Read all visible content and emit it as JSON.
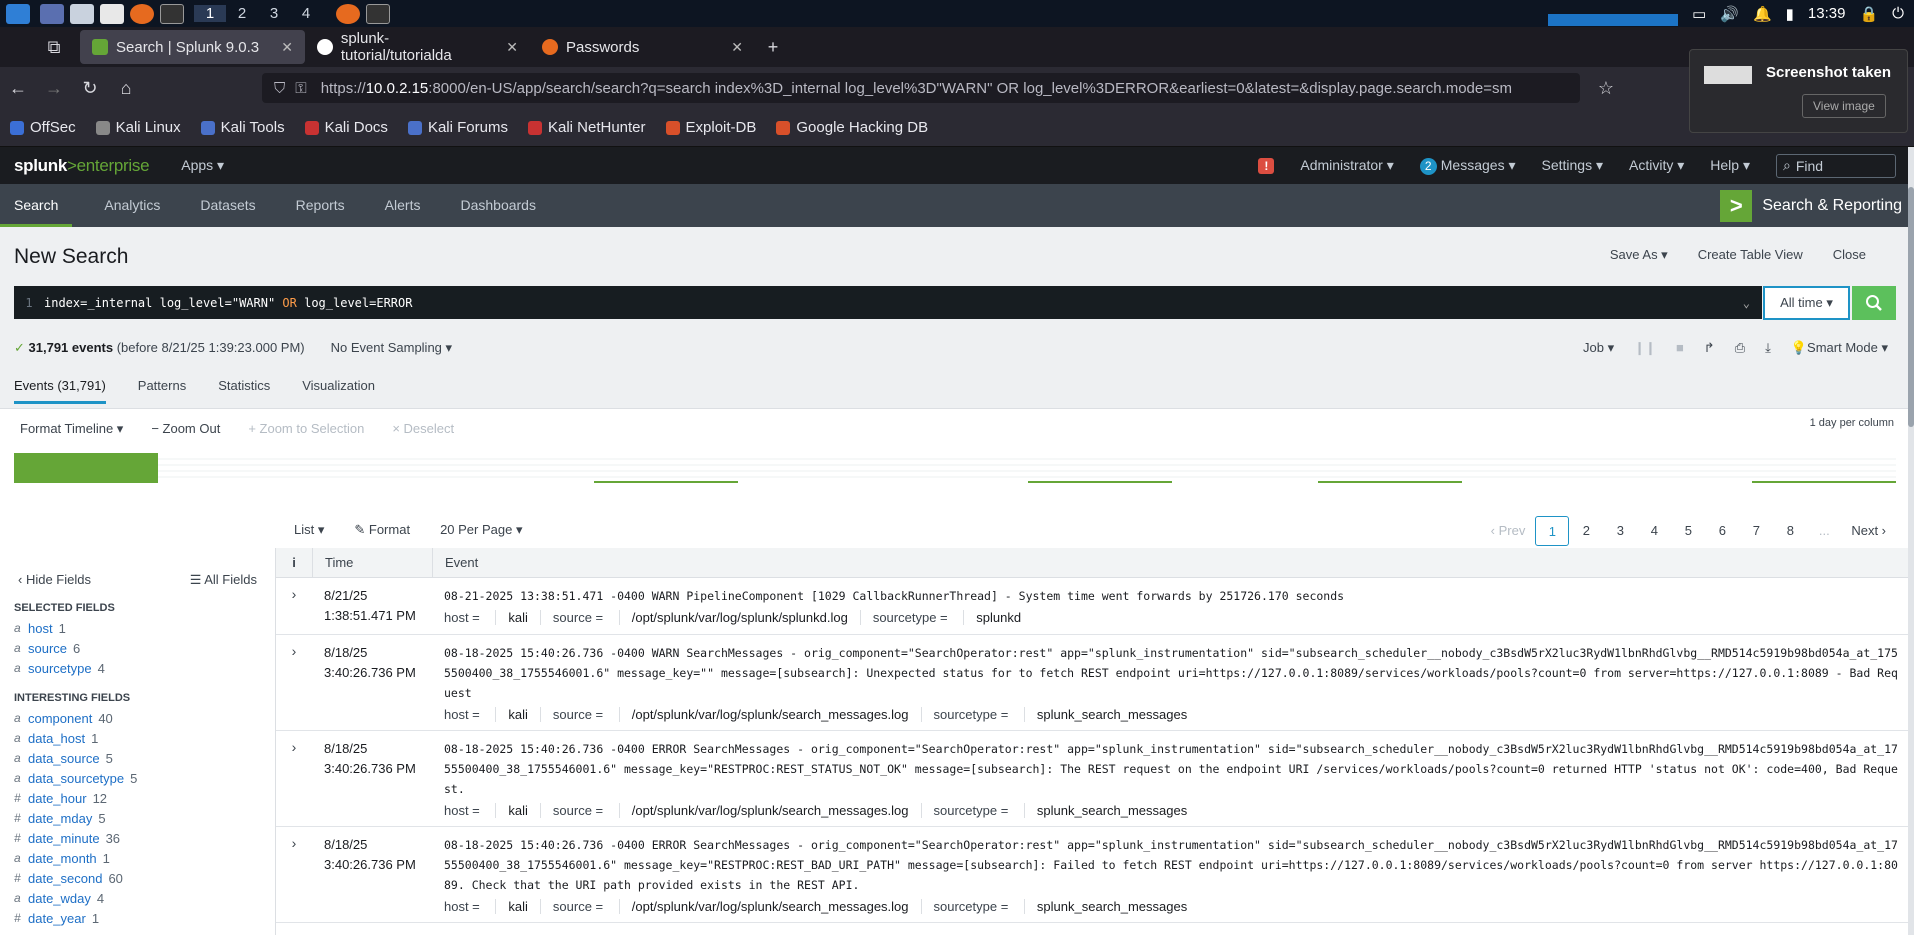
{
  "taskbar": {
    "workspaces": [
      "1",
      "2",
      "3",
      "4"
    ],
    "clock": "13:39"
  },
  "browser": {
    "tabs": [
      {
        "label": "Search | Splunk 9.0.3",
        "active": true
      },
      {
        "label": "splunk-tutorial/tutorialda",
        "active": false
      },
      {
        "label": "Passwords",
        "active": false
      }
    ],
    "url_prefix": "https://",
    "url_host": "10.0.2.15",
    "url_rest": ":8000/en-US/app/search/search?q=search index%3D_internal log_level%3D\"WARN\" OR log_level%3DERROR&earliest=0&latest=&display.page.search.mode=sm",
    "bookmarks": [
      "OffSec",
      "Kali Linux",
      "Kali Tools",
      "Kali Docs",
      "Kali Forums",
      "Kali NetHunter",
      "Exploit-DB",
      "Google Hacking DB"
    ]
  },
  "toast": {
    "title": "Screenshot taken",
    "button": "View image"
  },
  "splunk": {
    "logo_main": "splunk",
    "logo_accent": ">enterprise",
    "apps": "Apps ▾",
    "alert_glyph": "!",
    "user": "Administrator ▾",
    "messages_count": "2",
    "messages": "Messages ▾",
    "settings": "Settings ▾",
    "activity": "Activity ▾",
    "help": "Help ▾",
    "find_placeholder": "Find",
    "nav": [
      "Search",
      "Analytics",
      "Datasets",
      "Reports",
      "Alerts",
      "Dashboards"
    ],
    "app_name": "Search & Reporting"
  },
  "search": {
    "title": "New Search",
    "actions": [
      "Save As ▾",
      "Create Table View",
      "Close"
    ],
    "line_number": "1",
    "query_part1": "index=_internal log_level=\"WARN\" ",
    "query_or": "OR",
    "query_part2": " log_level=ERROR",
    "time_range": "All time ▾",
    "events_count": "31,791 events",
    "events_before": "(before 8/21/25 1:39:23.000 PM)",
    "sampling": "No Event Sampling ▾",
    "job": "Job ▾",
    "mode": "Smart Mode ▾"
  },
  "result_tabs": [
    "Events (31,791)",
    "Patterns",
    "Statistics",
    "Visualization"
  ],
  "timeline": {
    "tools": [
      "Format Timeline ▾",
      "− Zoom Out",
      "+ Zoom to Selection",
      "× Deselect"
    ],
    "scale": "1 day per column"
  },
  "list_tools": [
    "List ▾",
    "✎ Format",
    "20 Per Page ▾"
  ],
  "pager": {
    "prev": "‹ Prev",
    "pages": [
      "1",
      "2",
      "3",
      "4",
      "5",
      "6",
      "7",
      "8"
    ],
    "ellipsis": "...",
    "next": "Next ›"
  },
  "sidebar": {
    "hide": "‹ Hide Fields",
    "all": "☰ All Fields",
    "selected_title": "SELECTED FIELDS",
    "selected": [
      {
        "type": "a",
        "name": "host",
        "count": "1"
      },
      {
        "type": "a",
        "name": "source",
        "count": "6"
      },
      {
        "type": "a",
        "name": "sourcetype",
        "count": "4"
      }
    ],
    "interesting_title": "INTERESTING FIELDS",
    "interesting": [
      {
        "type": "a",
        "name": "component",
        "count": "40"
      },
      {
        "type": "a",
        "name": "data_host",
        "count": "1"
      },
      {
        "type": "a",
        "name": "data_source",
        "count": "5"
      },
      {
        "type": "a",
        "name": "data_sourcetype",
        "count": "5"
      },
      {
        "type": "#",
        "name": "date_hour",
        "count": "12"
      },
      {
        "type": "#",
        "name": "date_mday",
        "count": "5"
      },
      {
        "type": "#",
        "name": "date_minute",
        "count": "36"
      },
      {
        "type": "a",
        "name": "date_month",
        "count": "1"
      },
      {
        "type": "#",
        "name": "date_second",
        "count": "60"
      },
      {
        "type": "a",
        "name": "date_wday",
        "count": "4"
      },
      {
        "type": "#",
        "name": "date_year",
        "count": "1"
      }
    ]
  },
  "events_table": {
    "headers": [
      "i",
      "Time",
      "Event"
    ],
    "rows": [
      {
        "date": "8/21/25",
        "time": "1:38:51.471 PM",
        "raw": "08-21-2025 13:38:51.471 -0400 WARN  PipelineComponent [1029 CallbackRunnerThread] - System time went forwards by 251726.170 seconds",
        "host": "kali",
        "source": "/opt/splunk/var/log/splunk/splunkd.log",
        "sourcetype": "splunkd"
      },
      {
        "date": "8/18/25",
        "time": "3:40:26.736 PM",
        "raw": "08-18-2025 15:40:26.736 -0400 WARN  SearchMessages - orig_component=\"SearchOperator:rest\" app=\"splunk_instrumentation\" sid=\"subsearch_scheduler__nobody_c3BsdW5rX2luc3RydW1lbnRhdGlvbg__RMD514c5919b98bd054a_at_1755500400_38_1755546001.6\" message_key=\"\" message=[subsearch]: Unexpected status for to fetch REST endpoint uri=https://127.0.0.1:8089/services/workloads/pools?count=0 from server=https://127.0.0.1:8089 - Bad Request",
        "host": "kali",
        "source": "/opt/splunk/var/log/splunk/search_messages.log",
        "sourcetype": "splunk_search_messages"
      },
      {
        "date": "8/18/25",
        "time": "3:40:26.736 PM",
        "raw": "08-18-2025 15:40:26.736 -0400 ERROR SearchMessages - orig_component=\"SearchOperator:rest\" app=\"splunk_instrumentation\" sid=\"subsearch_scheduler__nobody_c3BsdW5rX2luc3RydW1lbnRhdGlvbg__RMD514c5919b98bd054a_at_1755500400_38_1755546001.6\" message_key=\"RESTPROC:REST_STATUS_NOT_OK\" message=[subsearch]: The REST request on the endpoint URI /services/workloads/pools?count=0 returned HTTP 'status not OK': code=400, Bad Request.",
        "host": "kali",
        "source": "/opt/splunk/var/log/splunk/search_messages.log",
        "sourcetype": "splunk_search_messages"
      },
      {
        "date": "8/18/25",
        "time": "3:40:26.736 PM",
        "raw": "08-18-2025 15:40:26.736 -0400 ERROR SearchMessages - orig_component=\"SearchOperator:rest\" app=\"splunk_instrumentation\" sid=\"subsearch_scheduler__nobody_c3BsdW5rX2luc3RydW1lbnRhdGlvbg__RMD514c5919b98bd054a_at_1755500400_38_1755546001.6\" message_key=\"RESTPROC:REST_BAD_URI_PATH\" message=[subsearch]: Failed to fetch REST endpoint uri=https://127.0.0.1:8089/services/workloads/pools?count=0 from server https://127.0.0.1:8089. Check that the URI path provided exists in the REST API.",
        "host": "kali",
        "source": "/opt/splunk/var/log/splunk/search_messages.log",
        "sourcetype": "splunk_search_messages"
      }
    ]
  },
  "meta_labels": {
    "host": "host = ",
    "source": "source = ",
    "sourcetype": "sourcetype = "
  },
  "colors": {
    "splunk_green": "#65a637",
    "accent_blue": "#1e93c6",
    "search_button": "#5cc05c"
  }
}
